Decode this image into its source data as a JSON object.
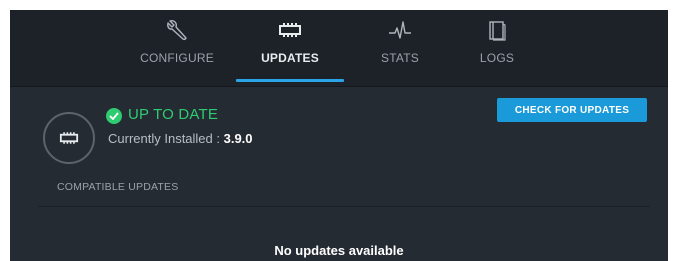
{
  "tabs": [
    {
      "label": "CONFIGURE",
      "icon": "wrench-icon",
      "active": false
    },
    {
      "label": "UPDATES",
      "icon": "firmware-chip-icon",
      "active": true
    },
    {
      "label": "STATS",
      "icon": "pulse-icon",
      "active": false
    },
    {
      "label": "LOGS",
      "icon": "book-icon",
      "active": false
    }
  ],
  "status": {
    "label": "UP TO DATE",
    "icon": "check-circle-icon",
    "color": "#2ecc71",
    "installed_prefix": "Currently Installed : ",
    "installed_version": "3.9.0"
  },
  "actions": {
    "check_updates_label": "CHECK FOR UPDATES",
    "button_color": "#1a9ad9"
  },
  "compatible": {
    "title": "COMPATIBLE UPDATES",
    "empty_message": "No updates available"
  },
  "theme": {
    "background": "#252b33",
    "nav_background": "#1d2228",
    "accent": "#2aa4e6"
  }
}
